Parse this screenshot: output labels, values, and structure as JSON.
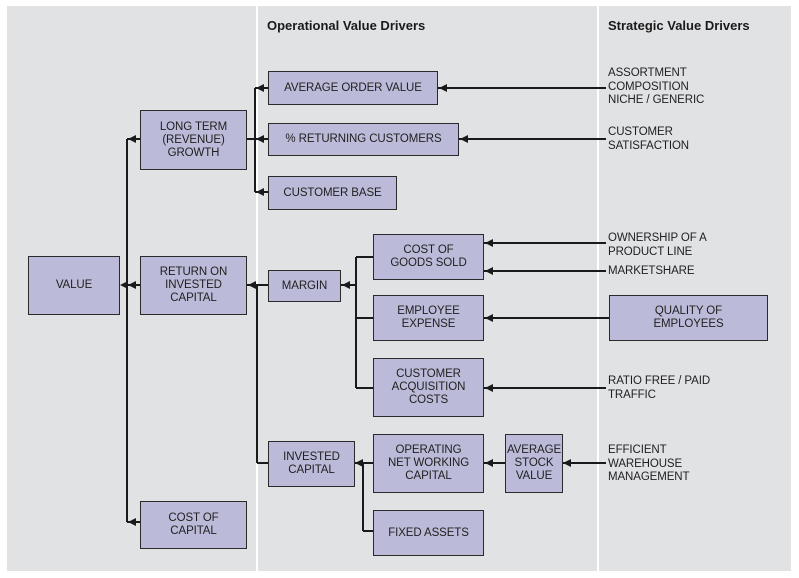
{
  "columns": {
    "operational": "Operational Value Drivers",
    "strategic": "Strategic Value Drivers"
  },
  "nodes": {
    "value": "VALUE",
    "long_term_growth": "LONG TERM\n(REVENUE)\nGROWTH",
    "roic": "RETURN ON\nINVESTED\nCAPITAL",
    "cost_of_capital": "COST OF\nCAPITAL",
    "average_order_value": "AVERAGE ORDER VALUE",
    "returning_customers": "% RETURNING CUSTOMERS",
    "customer_base": "CUSTOMER BASE",
    "margin": "MARGIN",
    "invested_capital": "INVESTED\nCAPITAL",
    "cogs": "COST OF\nGOODS SOLD",
    "employee_expense": "EMPLOYEE\nEXPENSE",
    "customer_acquisition_costs": "CUSTOMER\nACQUISITION\nCOSTS",
    "operating_nwc": "OPERATING\nNET WORKING\nCAPITAL",
    "fixed_assets": "FIXED ASSETS",
    "average_stock_value": "AVERAGE\nSTOCK\nVALUE",
    "quality_of_employees": "QUALITY OF\nEMPLOYEES"
  },
  "strategic_labels": {
    "assortment": "ASSORTMENT\nCOMPOSITION\nNICHE / GENERIC",
    "customer_satisfaction": "CUSTOMER\nSATISFACTION",
    "ownership": "OWNERSHIP OF A\nPRODUCT LINE",
    "marketshare": "MARKETSHARE",
    "ratio_traffic": "RATIO FREE / PAID\nTRAFFIC",
    "warehouse": "EFFICIENT\nWAREHOUSE\nMANAGEMENT"
  },
  "colors": {
    "panel": "#e1e2e4",
    "box_fill": "#bbbbd9",
    "line": "#1a1a1a"
  }
}
